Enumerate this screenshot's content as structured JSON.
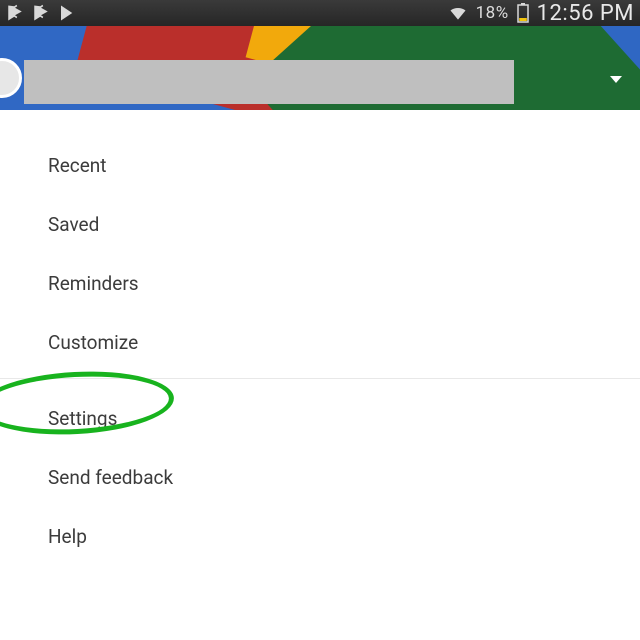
{
  "status": {
    "battery_percent": "18%",
    "time": "12:56 PM"
  },
  "header": {
    "search_value": ""
  },
  "menu": {
    "items": [
      {
        "label": "Recent"
      },
      {
        "label": "Saved"
      },
      {
        "label": "Reminders"
      },
      {
        "label": "Customize"
      }
    ],
    "items_after_divider": [
      {
        "label": "Settings"
      },
      {
        "label": "Send feedback"
      },
      {
        "label": "Help"
      }
    ]
  },
  "annotation": {
    "highlighted_item": "Settings"
  }
}
